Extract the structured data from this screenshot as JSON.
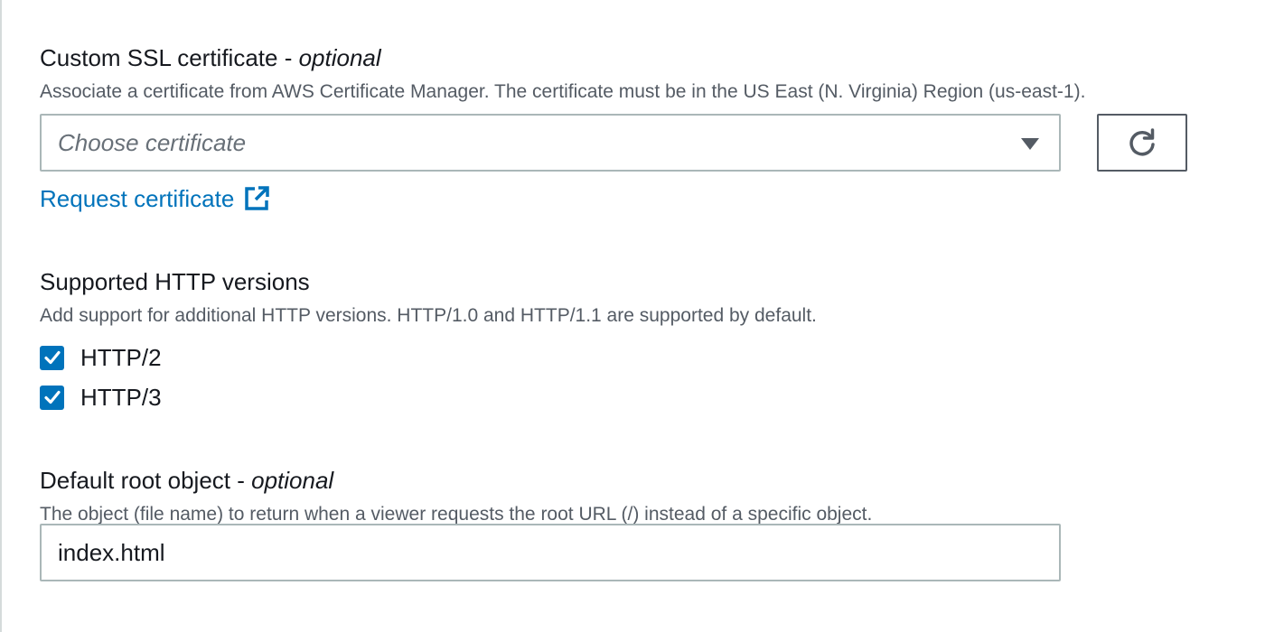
{
  "ssl": {
    "label": "Custom SSL certificate - ",
    "optional": "optional",
    "description": "Associate a certificate from AWS Certificate Manager. The certificate must be in the US East (N. Virginia) Region (us-east-1).",
    "select_placeholder": "Choose certificate",
    "refresh_icon": "refresh-icon",
    "request_link": "Request certificate",
    "external_icon": "external-link-icon"
  },
  "http": {
    "label": "Supported HTTP versions",
    "description": "Add support for additional HTTP versions. HTTP/1.0 and HTTP/1.1 are supported by default.",
    "options": [
      {
        "label": "HTTP/2",
        "checked": true
      },
      {
        "label": "HTTP/3",
        "checked": true
      }
    ]
  },
  "root_object": {
    "label": "Default root object - ",
    "optional": "optional",
    "description": "The object (file name) to return when a viewer requests the root URL (/) instead of a specific object.",
    "value": "index.html"
  },
  "colors": {
    "accent": "#0073bb",
    "border": "#aab7b8",
    "text": "#16191f",
    "muted": "#545b64"
  }
}
